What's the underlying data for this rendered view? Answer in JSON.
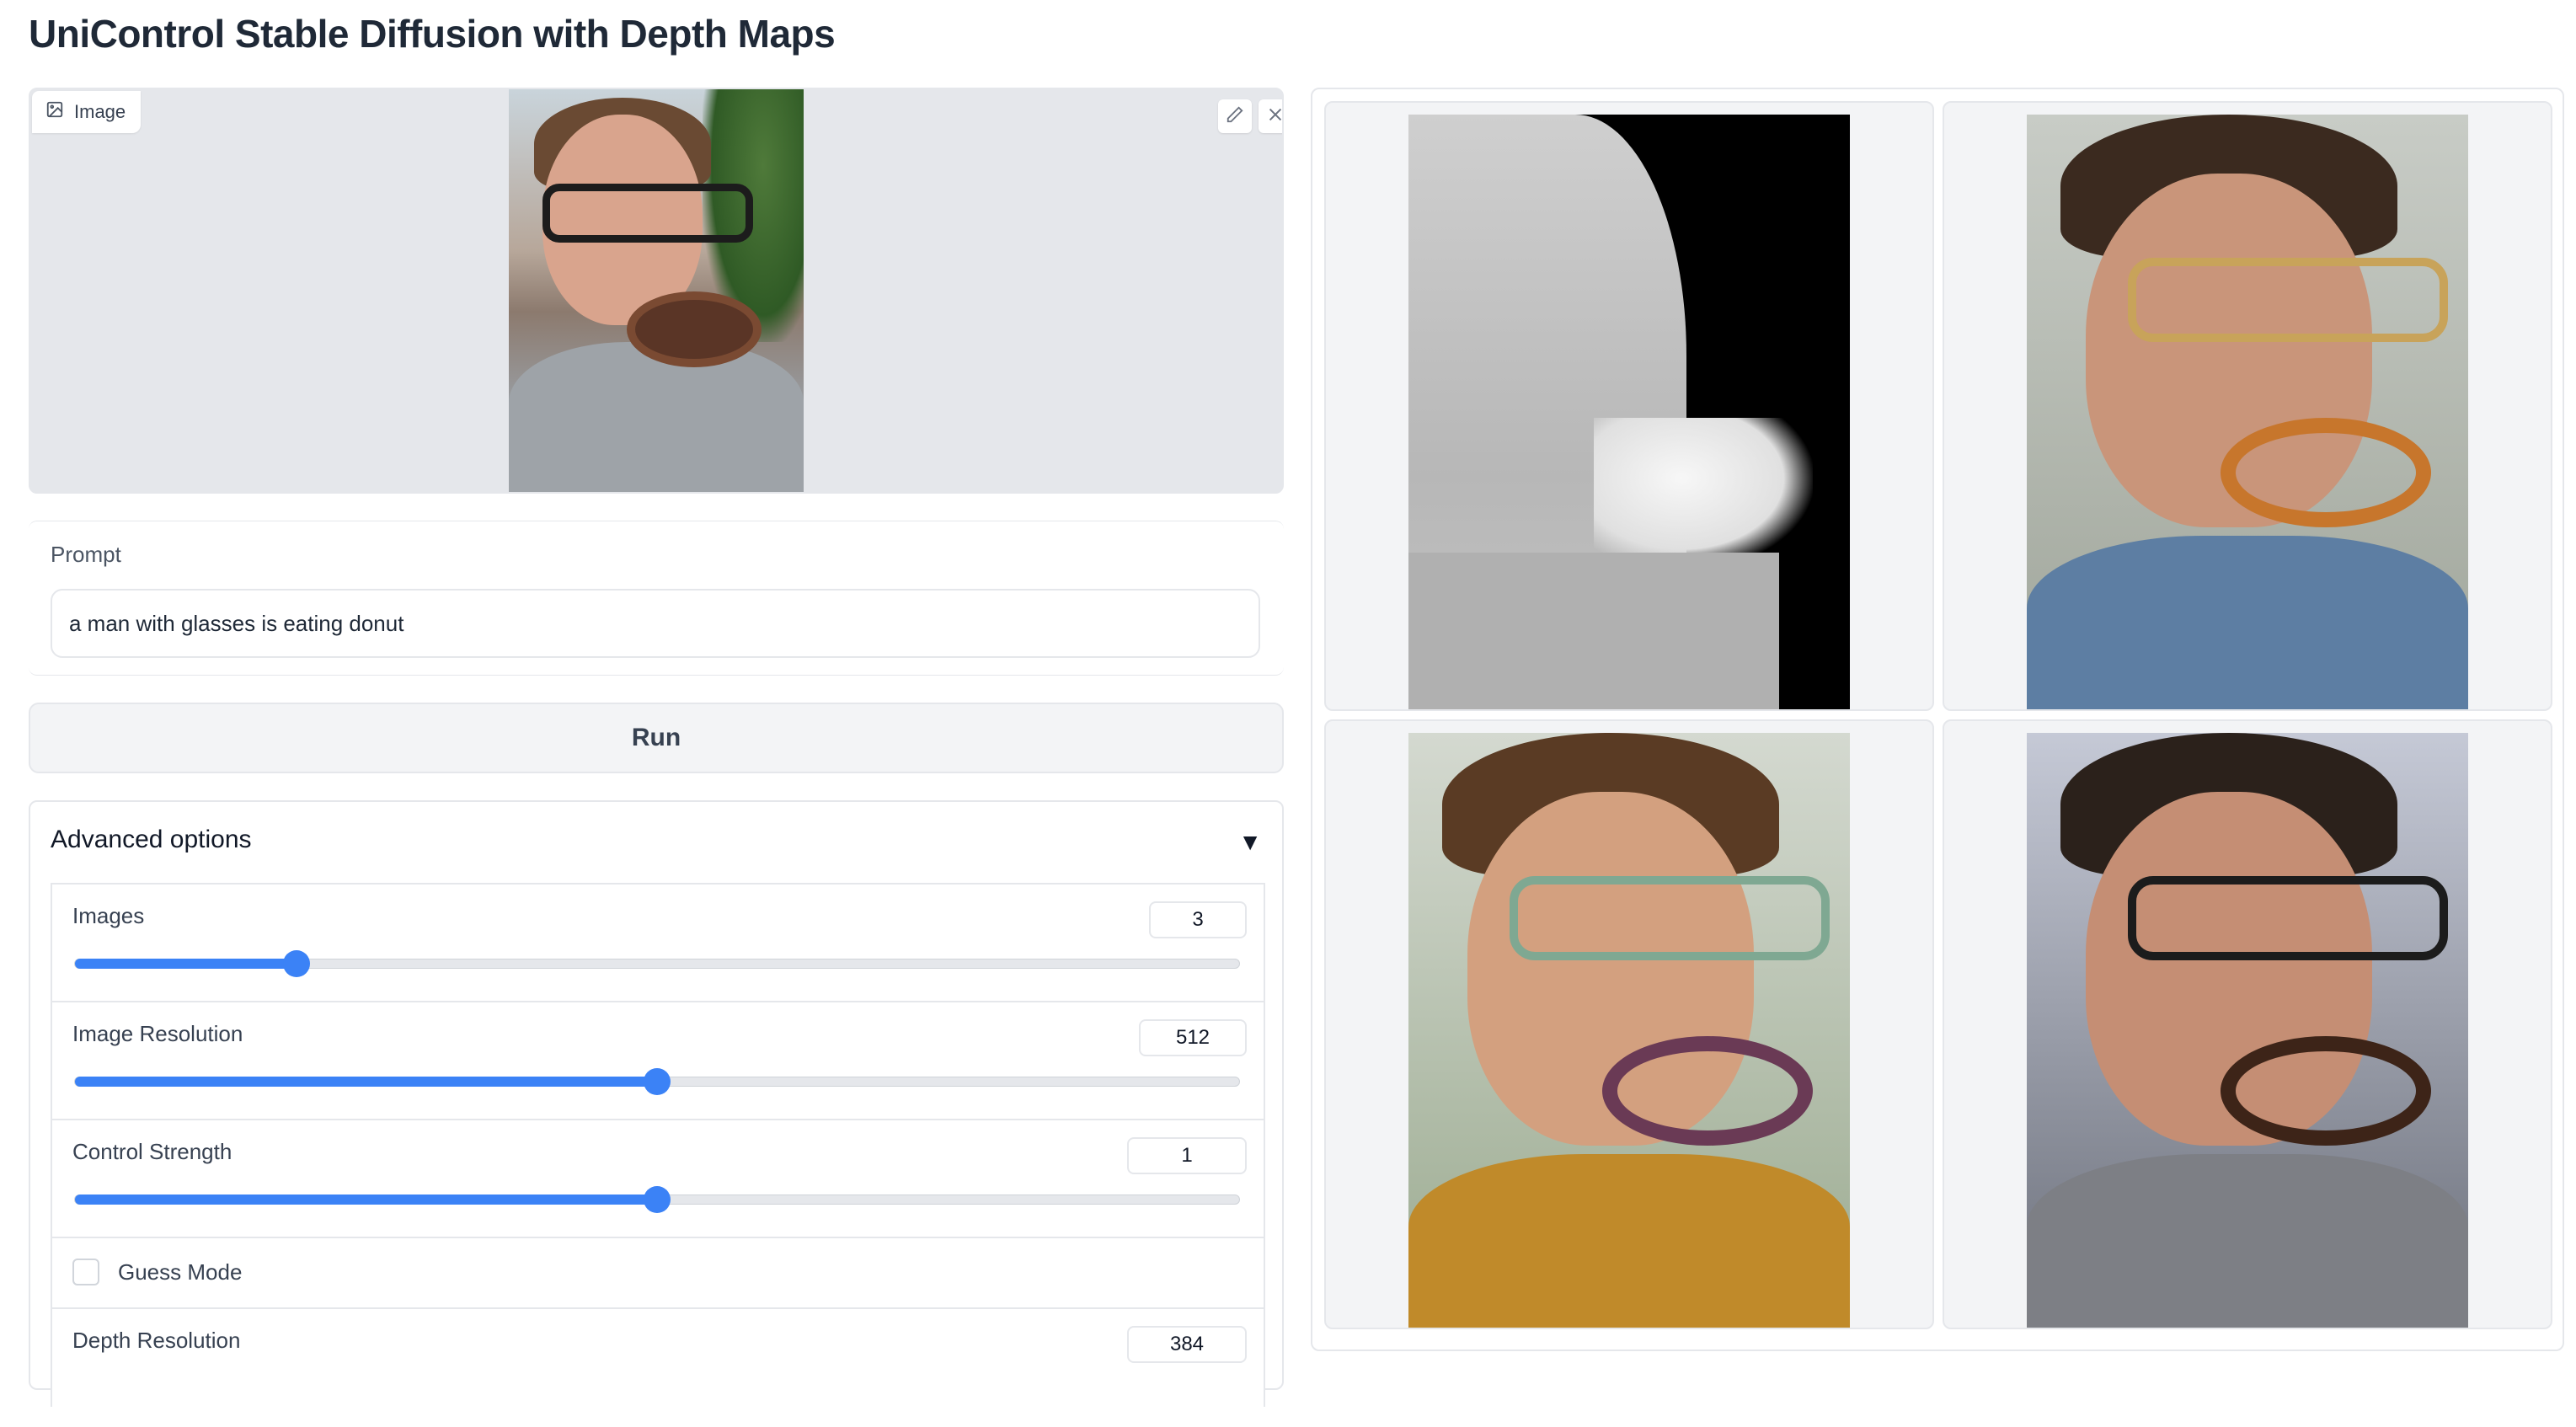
{
  "app": {
    "title": "UniControl Stable Diffusion with Depth Maps"
  },
  "image_input": {
    "label": "Image",
    "edit_icon": "pencil-icon",
    "clear_icon": "close-icon"
  },
  "prompt": {
    "label": "Prompt",
    "value": "a man with glasses is eating donut"
  },
  "run": {
    "label": "Run"
  },
  "advanced": {
    "header": "Advanced options",
    "toggle_glyph": "▼",
    "images": {
      "label": "Images",
      "value": "3",
      "fraction": 0.19
    },
    "resolution": {
      "label": "Image Resolution",
      "value": "512",
      "fraction": 0.5
    },
    "strength": {
      "label": "Control Strength",
      "value": "1",
      "fraction": 0.5
    },
    "guess_mode": {
      "label": "Guess Mode",
      "checked": false
    },
    "depth_resolution": {
      "label": "Depth Resolution",
      "value": "384"
    }
  },
  "gallery": {
    "items": [
      {
        "kind": "depth-map"
      },
      {
        "kind": "generated",
        "theme": "caramel-donut"
      },
      {
        "kind": "generated",
        "theme": "sprinkle-donut"
      },
      {
        "kind": "generated",
        "theme": "chocolate-donut"
      }
    ]
  },
  "colors": {
    "accent": "#3b82f6",
    "border": "#e5e7eb",
    "panel_bg": "#f3f4f6"
  }
}
